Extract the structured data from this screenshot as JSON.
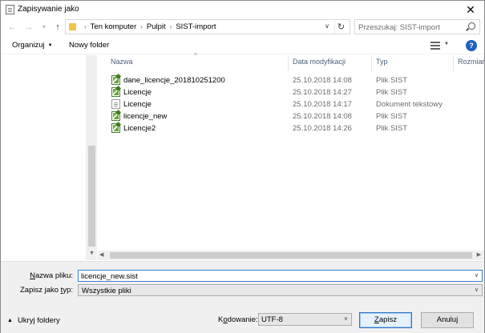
{
  "window": {
    "title": "Zapisywanie jako",
    "close_label": "✕"
  },
  "address_bar": {
    "breadcrumbs": [
      "Ten komputer",
      "Pulpit",
      "SIST-import"
    ],
    "separator": "›",
    "search_placeholder": "Przeszukaj: SIST-import"
  },
  "toolbar": {
    "organize_label": "Organizuj",
    "new_folder_label": "Nowy folder"
  },
  "file_list": {
    "columns": {
      "name": "Nazwa",
      "date": "Data modyfikacji",
      "type": "Typ",
      "size": "Rozmiar"
    },
    "rows": [
      {
        "name": "dane_licencje_201810251200",
        "date": "25.10.2018 14:08",
        "type": "Plik SIST",
        "icon": "sist-file-icon"
      },
      {
        "name": "Licencje",
        "date": "25.10.2018 14:27",
        "type": "Plik SIST",
        "icon": "sist-file-icon"
      },
      {
        "name": "Licencje",
        "date": "25.10.2018 14:17",
        "type": "Dokument tekstowy",
        "icon": "text-file-icon"
      },
      {
        "name": "licencje_new",
        "date": "25.10.2018 14:08",
        "type": "Plik SIST",
        "icon": "sist-file-icon"
      },
      {
        "name": "Licencje2",
        "date": "25.10.2018 14:26",
        "type": "Plik SIST",
        "icon": "sist-file-icon"
      }
    ]
  },
  "form": {
    "filename_label_u": "N",
    "filename_label_rest": "azwa pliku:",
    "filename_value": "licencje_new.sist",
    "filetype_label_pre": "Zapisz jako ",
    "filetype_label_u": "t",
    "filetype_label_rest": "yp:",
    "filetype_value": "Wszystkie pliki",
    "hide_folders_label": "Ukryj foldery",
    "encoding_label_pre": "K",
    "encoding_label_u": "o",
    "encoding_label_rest": "dowanie:",
    "encoding_value": "UTF-8",
    "save_label_u": "Z",
    "save_label_rest": "apisz",
    "cancel_label": "Anuluj"
  },
  "colors": {
    "accent": "#1f5fbf",
    "column_header": "#4c607a",
    "secondary_text": "#6d6d6d"
  }
}
